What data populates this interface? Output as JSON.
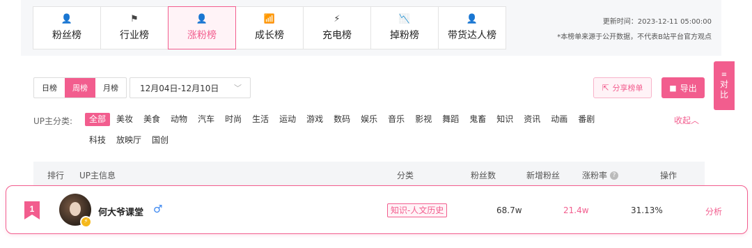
{
  "tabs": [
    {
      "label": "粉丝榜",
      "icon": "user-icon",
      "glyph": "👤"
    },
    {
      "label": "行业榜",
      "icon": "flag-icon",
      "glyph": "⚑"
    },
    {
      "label": "涨粉榜",
      "icon": "user-plus-icon",
      "glyph": "👤",
      "active": true
    },
    {
      "label": "成长榜",
      "icon": "growth-icon",
      "glyph": "📶"
    },
    {
      "label": "充电榜",
      "icon": "lightning-icon",
      "glyph": "⚡"
    },
    {
      "label": "掉粉榜",
      "icon": "decline-icon",
      "glyph": "📉"
    },
    {
      "label": "带货达人榜",
      "icon": "user-icon",
      "glyph": "👤"
    }
  ],
  "info": {
    "update_time": "更新时间：2023-12-11 05:00:00",
    "disclaimer": "*本榜单来源于公开数据，不代表B站平台官方观点"
  },
  "period": {
    "day": "日榜",
    "week": "周榜",
    "month": "月榜",
    "selected": "周榜"
  },
  "date_range": "12月04日-12月10日",
  "actions": {
    "share": "分享榜单",
    "export": "导出"
  },
  "compare": {
    "label": "对比"
  },
  "categories": {
    "label": "UP主分类:",
    "row1": [
      "全部",
      "美妆",
      "美食",
      "动物",
      "汽车",
      "时尚",
      "生活",
      "运动",
      "游戏",
      "数码",
      "娱乐",
      "音乐",
      "影视",
      "舞蹈",
      "鬼畜",
      "知识",
      "资讯",
      "动画",
      "番剧"
    ],
    "row2": [
      "科技",
      "放映厅",
      "国创"
    ],
    "selected": "全部",
    "collapse": "收起︿"
  },
  "table": {
    "headers": {
      "rank": "排行",
      "up": "UP主信息",
      "category": "分类",
      "fans": "粉丝数",
      "new_fans": "新增粉丝",
      "rate": "涨粉率",
      "op": "操作"
    },
    "rows": [
      {
        "rank": "1",
        "name": "何大爷课堂",
        "gender": "♂",
        "category": "知识-人文历史",
        "fans": "68.7w",
        "new_fans": "21.4w",
        "rate": "31.13%",
        "action": "分析"
      }
    ]
  },
  "colors": {
    "accent": "#f25d8e",
    "male": "#3a86f0",
    "verify": "#f5b81b"
  }
}
